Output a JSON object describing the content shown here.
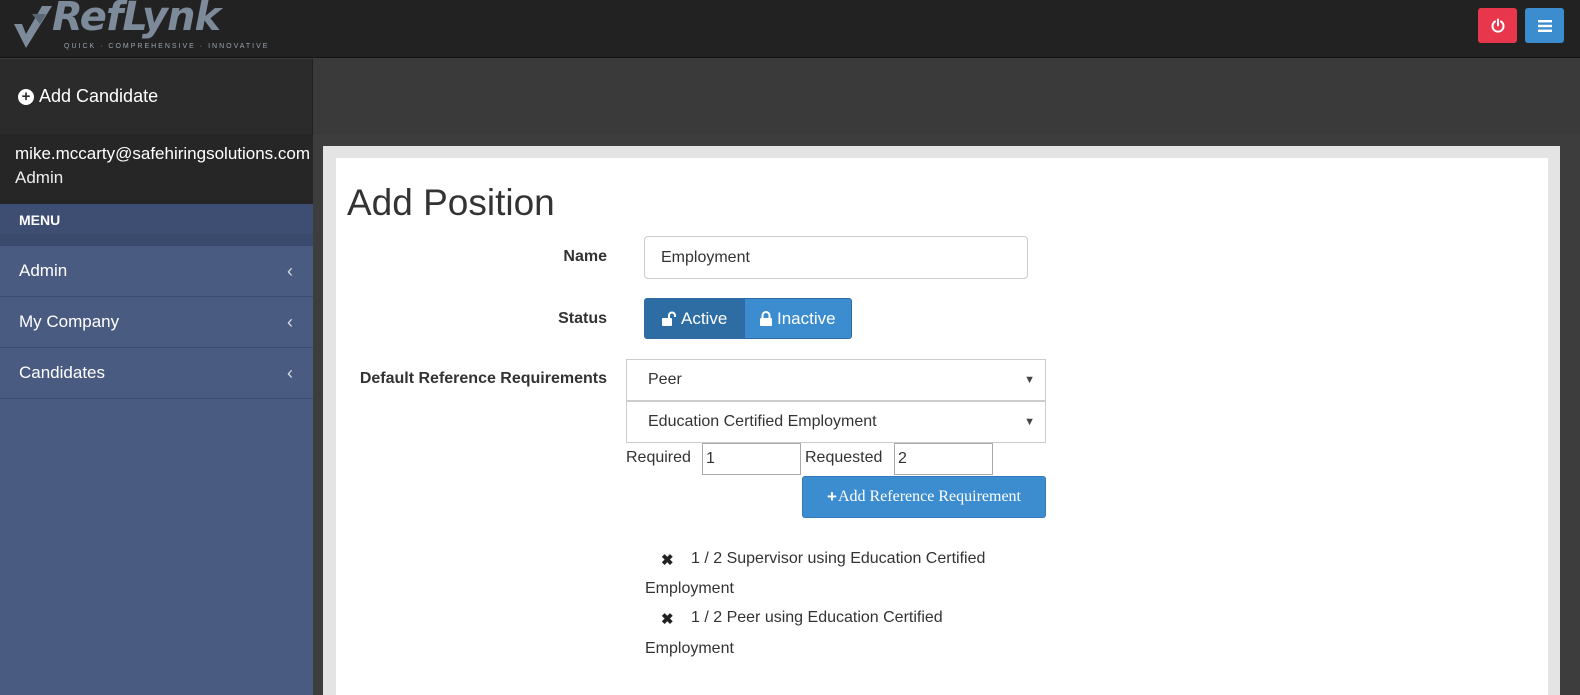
{
  "app": {
    "logo_text": "RefLynk",
    "tagline": "QUICK · COMPREHENSIVE · INNOVATIVE"
  },
  "header": {
    "power_icon": "power-icon",
    "menu_icon": "hamburger-icon",
    "power_color": "#e8364d",
    "menu_color": "#3c8dd0"
  },
  "subheader": {
    "add_candidate_label": "Add Candidate"
  },
  "sidebar": {
    "user_email": "mike.mccarty@safehiringsolutions.com",
    "user_role": "Admin",
    "menu_header": "MENU",
    "items": [
      {
        "label": "Admin"
      },
      {
        "label": "My Company"
      },
      {
        "label": "Candidates"
      }
    ]
  },
  "form": {
    "title": "Add Position",
    "name_label": "Name",
    "name_value": "Employment",
    "status_label": "Status",
    "status_active": "Active",
    "status_inactive": "Inactive",
    "status_selected": "Active",
    "ref_req_label": "Default Reference Requirements",
    "type_select": "Peer",
    "category_select": "Education Certified Employment",
    "required_label": "Required",
    "required_value": "1",
    "requested_label": "Requested",
    "requested_value": "2",
    "add_req_button": "Add Reference Requirement",
    "requirements": [
      {
        "line1": "1 / 2 Supervisor using Education Certified",
        "line2": "Employment"
      },
      {
        "line1": "1 / 2 Peer using Education Certified",
        "line2": "Employment"
      }
    ]
  }
}
